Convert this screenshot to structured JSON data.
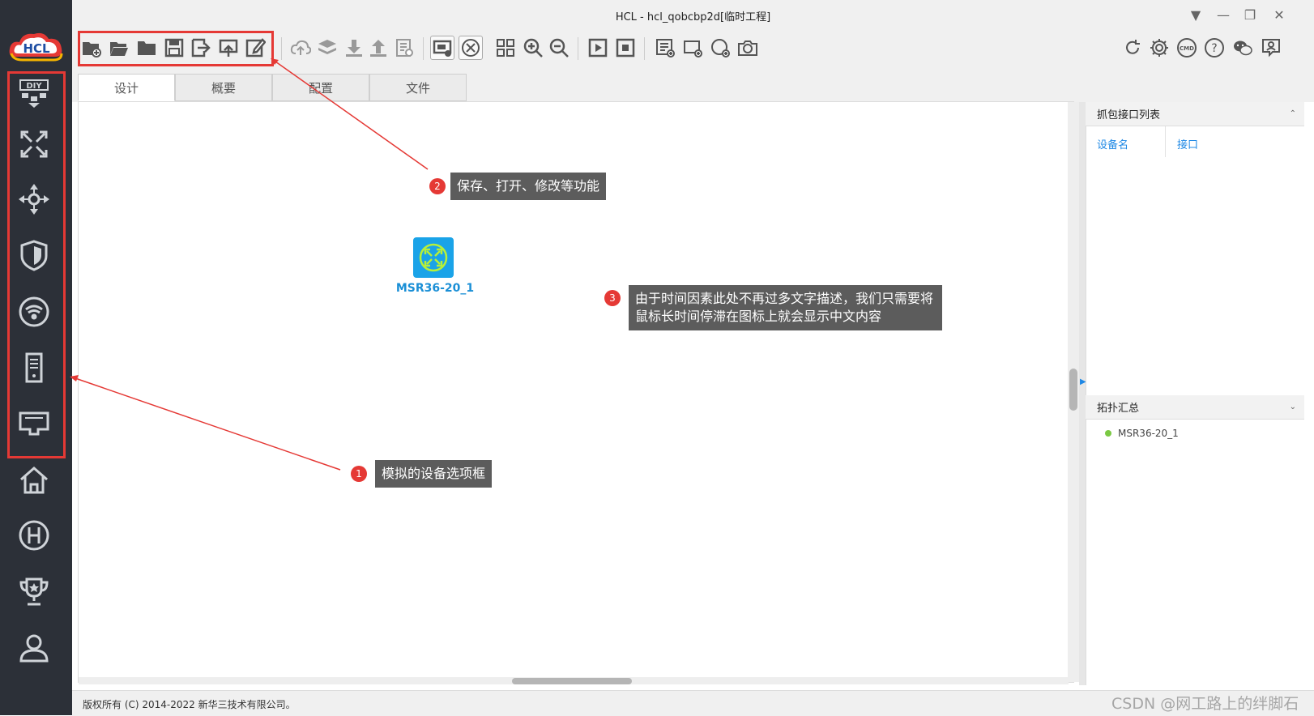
{
  "app": {
    "logo_text": "HCL",
    "window_title": "HCL - hcl_qobcbp2d[临时工程]"
  },
  "sidebar": {
    "items": [
      {
        "name": "diy-icon",
        "label": "DIY"
      },
      {
        "name": "router-icon"
      },
      {
        "name": "switch-icon"
      },
      {
        "name": "firewall-shield-icon"
      },
      {
        "name": "wireless-icon"
      },
      {
        "name": "server-icon"
      },
      {
        "name": "terminal-pc-icon"
      },
      {
        "name": "home-icon"
      },
      {
        "name": "h-logo-icon"
      },
      {
        "name": "trophy-icon"
      },
      {
        "name": "user-icon"
      }
    ]
  },
  "tabs": [
    {
      "label": "设计",
      "active": true
    },
    {
      "label": "概要",
      "active": false
    },
    {
      "label": "配置",
      "active": false
    },
    {
      "label": "文件",
      "active": false
    }
  ],
  "device": {
    "label": "MSR36-20_1",
    "color": "#1aa3e8"
  },
  "callouts": [
    {
      "number": "1",
      "text": "模拟的设备选项框"
    },
    {
      "number": "2",
      "text": "保存、打开、修改等功能"
    },
    {
      "number": "3",
      "text_line1": "由于时间因素此处不再过多文字描述，我们只需要将",
      "text_line2": "鼠标长时间停滞在图标上就会显示中文内容"
    }
  ],
  "capture_panel": {
    "title": "抓包接口列表",
    "col_device": "设备名",
    "col_interface": "接口"
  },
  "topology_panel": {
    "title": "拓扑汇总",
    "items": [
      {
        "label": "MSR36-20_1",
        "status_color": "#7ac943"
      }
    ]
  },
  "status": {
    "copyright": "版权所有 (C) 2014-2022 新华三技术有限公司。",
    "watermark": "CSDN @网工路上的绊脚石"
  },
  "colors": {
    "sidebar_bg": "#2c3038",
    "highlight_red": "#e53935",
    "accent_blue": "#1e88e5"
  }
}
